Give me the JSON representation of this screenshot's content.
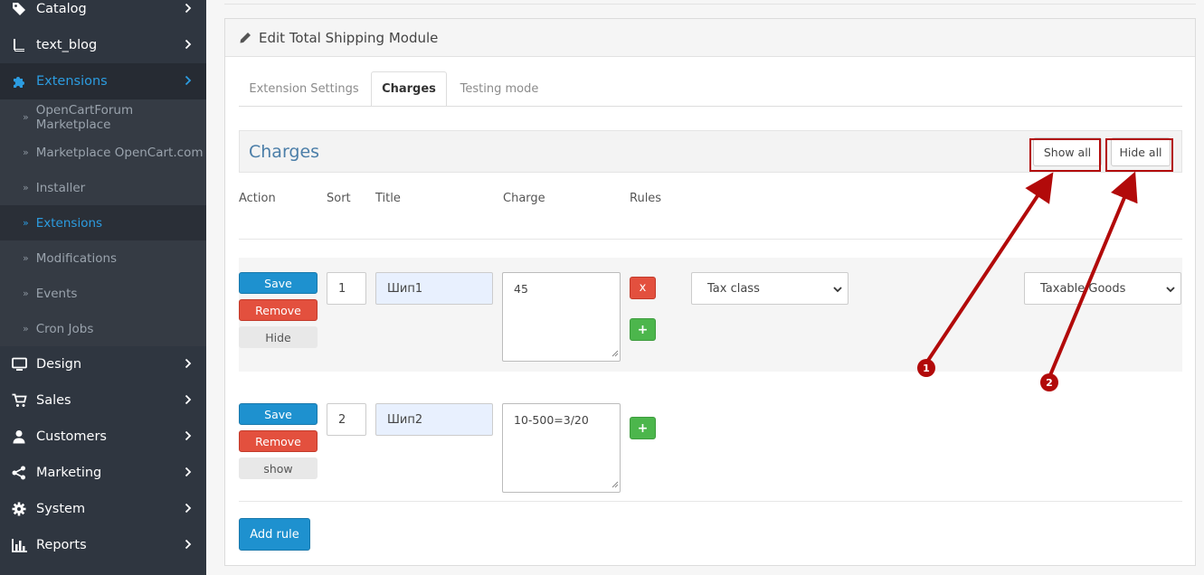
{
  "sidebar": {
    "items": [
      {
        "label": "Catalog",
        "icon": "tag-icon"
      },
      {
        "label": "text_blog",
        "icon": "book-icon"
      },
      {
        "label": "Extensions",
        "icon": "puzzle-icon"
      },
      {
        "label": "Design",
        "icon": "monitor-icon"
      },
      {
        "label": "Sales",
        "icon": "cart-icon"
      },
      {
        "label": "Customers",
        "icon": "user-icon"
      },
      {
        "label": "Marketing",
        "icon": "share-icon"
      },
      {
        "label": "System",
        "icon": "gear-icon"
      },
      {
        "label": "Reports",
        "icon": "bar-chart-icon"
      }
    ],
    "sub_items": [
      "OpenCartForum Marketplace",
      "Marketplace OpenCart.com",
      "Installer",
      "Extensions",
      "Modifications",
      "Events",
      "Cron Jobs"
    ],
    "active_color": "#2c9ce0"
  },
  "panel": {
    "title": "Edit Total Shipping Module",
    "tabs": [
      "Extension Settings",
      "Charges",
      "Testing mode"
    ],
    "active_tab": "Charges"
  },
  "charges": {
    "heading": "Charges",
    "show_all": "Show all",
    "hide_all": "Hide all",
    "columns": [
      "Action",
      "Sort",
      "Title",
      "Charge",
      "Rules"
    ],
    "rows": [
      {
        "save": "Save",
        "remove": "Remove",
        "toggle": "Hide",
        "sort": "1",
        "title": "Шип1",
        "charge": "45",
        "rule_remove": "x",
        "rule_add": "+",
        "rule_select_1": "Tax class",
        "rule_select_2": "Taxable Goods"
      },
      {
        "save": "Save",
        "remove": "Remove",
        "toggle": "show",
        "sort": "2",
        "title": "Шип2",
        "charge": "10-500=3/20",
        "rule_add": "+"
      }
    ],
    "add_rule": "Add rule"
  },
  "annotations": {
    "marker_1": "1",
    "marker_2": "2",
    "color": "#b20a0a"
  }
}
